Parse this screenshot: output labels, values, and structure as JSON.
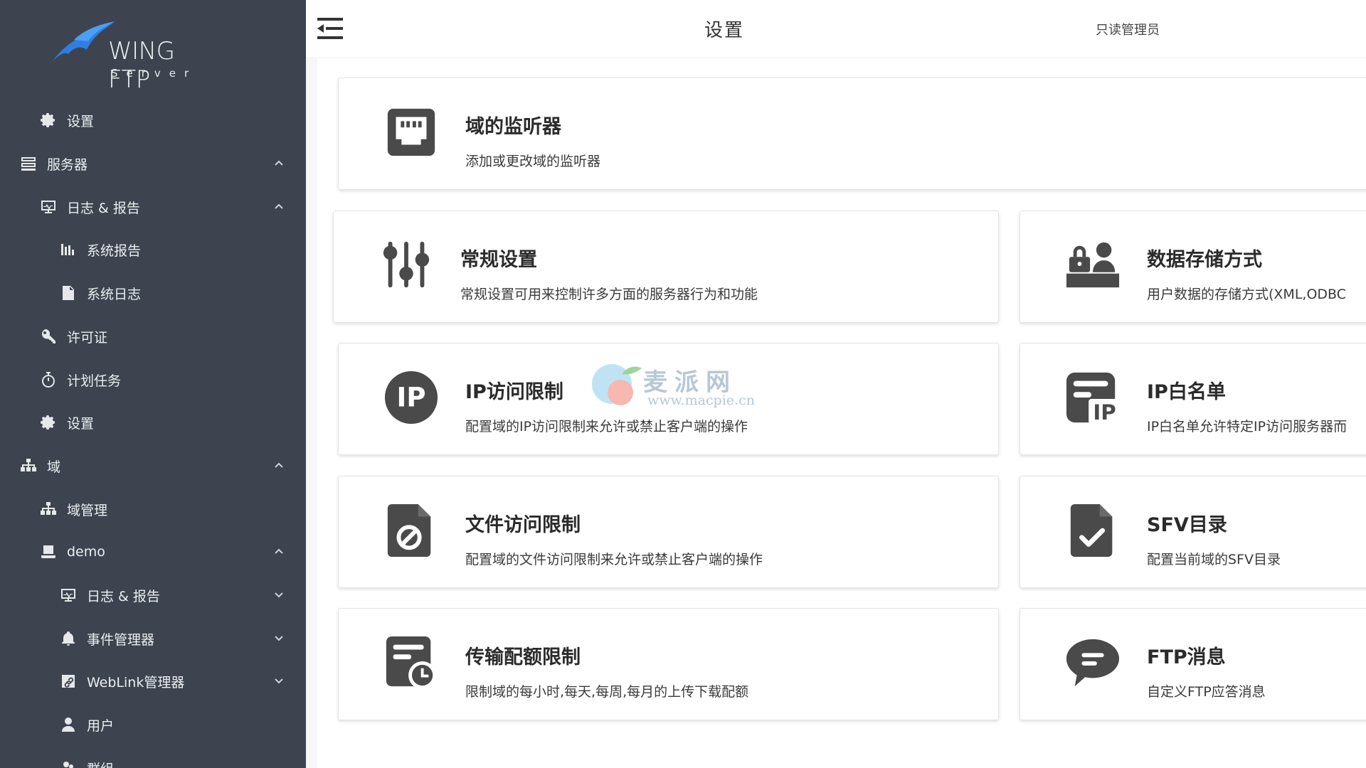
{
  "app": {
    "logo_name": "WING FTP",
    "logo_sub": "Server"
  },
  "header": {
    "title": "设置",
    "user_role": "只读管理员"
  },
  "sidebar": {
    "items": [
      {
        "label": "设置",
        "icon": "gear-icon"
      },
      {
        "label": "服务器",
        "icon": "server-icon"
      },
      {
        "label": "日志 & 报告",
        "icon": "monitor-icon"
      },
      {
        "label": "系统报告",
        "icon": "bar-chart-icon"
      },
      {
        "label": "系统日志",
        "icon": "document-icon"
      },
      {
        "label": "许可证",
        "icon": "key-icon"
      },
      {
        "label": "计划任务",
        "icon": "stopwatch-icon"
      },
      {
        "label": "设置",
        "icon": "gear-icon"
      },
      {
        "label": "域",
        "icon": "sitemap-icon"
      },
      {
        "label": "域管理",
        "icon": "sitemap-icon"
      },
      {
        "label": "demo",
        "icon": "laptop-icon"
      },
      {
        "label": "日志 & 报告",
        "icon": "monitor-icon"
      },
      {
        "label": "事件管理器",
        "icon": "bell-icon"
      },
      {
        "label": "WebLink管理器",
        "icon": "link-icon"
      },
      {
        "label": "用户",
        "icon": "user-icon"
      },
      {
        "label": "群组",
        "icon": "group-icon"
      }
    ]
  },
  "cards": [
    {
      "title": "域的监听器",
      "desc": "添加或更改域的监听器",
      "icon": "ethernet-port-icon"
    },
    {
      "title": "常规设置",
      "desc": "常规设置可用来控制许多方面的服务器行为和功能",
      "icon": "sliders-icon"
    },
    {
      "title": "数据存储方式",
      "desc": "用户数据的存储方式(XML,ODBC",
      "icon": "user-lock-icon"
    },
    {
      "title": "IP访问限制",
      "desc": "配置域的IP访问限制来允许或禁止客户端的操作",
      "icon": "ip-circle-icon"
    },
    {
      "title": "IP白名单",
      "desc": "IP白名单允许特定IP访问服务器而",
      "icon": "ip-list-icon"
    },
    {
      "title": "文件访问限制",
      "desc": "配置域的文件访问限制来允许或禁止客户端的操作",
      "icon": "file-ban-icon"
    },
    {
      "title": "SFV目录",
      "desc": "配置当前域的SFV目录",
      "icon": "file-check-icon"
    },
    {
      "title": "传输配额限制",
      "desc": "限制域的每小时,每天,每周,每月的上传下载配额",
      "icon": "quota-clock-icon"
    },
    {
      "title": "FTP消息",
      "desc": "自定义FTP应答消息",
      "icon": "message-bubble-icon"
    }
  ],
  "watermark": {
    "title": "麦派网",
    "url": "www.macpie.cn"
  },
  "colors": {
    "sidebar_bg": "#3d4450",
    "icon_dark": "#4a4a4a"
  }
}
